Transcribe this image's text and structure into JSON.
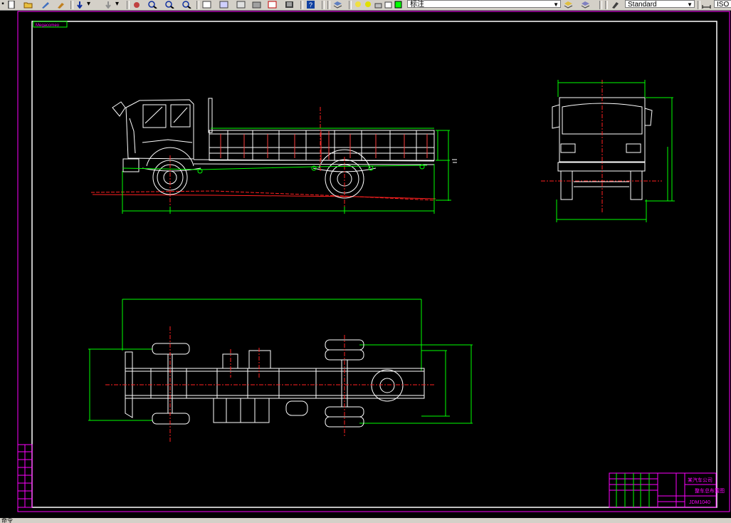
{
  "toolbar": {
    "dimension_style_value": "标注",
    "text_style_value": "Standard",
    "scale_value": "ISO"
  },
  "drawing": {
    "logo_text": "Megacomeo",
    "title_block": {
      "drawing_name": "整车总布置图",
      "company": "某汽车公司",
      "model_number": "JDM1040"
    },
    "colors": {
      "background": "#000000",
      "outline": "#ffffff",
      "dimensions": "#00ff00",
      "centerlines": "#ff0000",
      "frame": "#ff00ff"
    }
  },
  "status": {
    "command_prompt": "命令"
  }
}
